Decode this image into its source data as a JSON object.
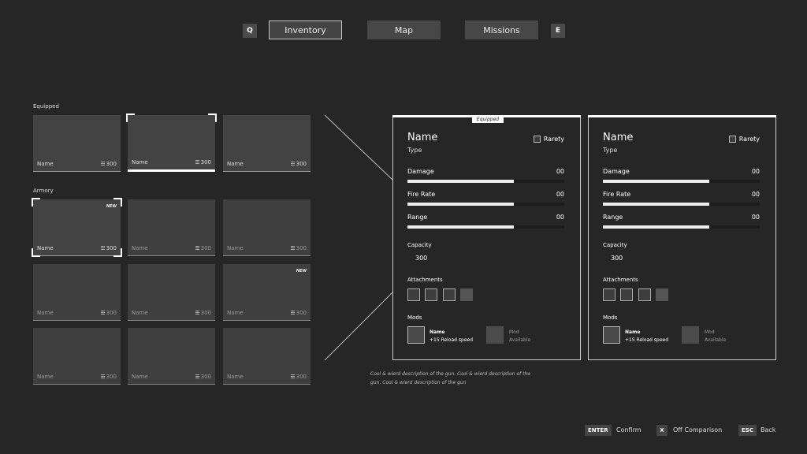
{
  "nav": {
    "prev_key": "Q",
    "next_key": "E",
    "tabs": [
      {
        "label": "Inventory",
        "active": true
      },
      {
        "label": "Map",
        "active": false
      },
      {
        "label": "Missions",
        "active": false
      }
    ]
  },
  "equipped": {
    "label": "Equipped",
    "items": [
      {
        "name": "Name",
        "price": "300"
      },
      {
        "name": "Name",
        "price": "300"
      },
      {
        "name": "Name",
        "price": "300"
      }
    ]
  },
  "armory": {
    "label": "Armory",
    "items": [
      {
        "name": "Name",
        "price": "300",
        "badge": "NEW"
      },
      {
        "name": "Name",
        "price": "300"
      },
      {
        "name": "Name",
        "price": "300"
      },
      {
        "name": "Name",
        "price": "300"
      },
      {
        "name": "Name",
        "price": "300"
      },
      {
        "name": "Name",
        "price": "300",
        "badge": "NEW"
      },
      {
        "name": "Name",
        "price": "300"
      },
      {
        "name": "Name",
        "price": "300"
      },
      {
        "name": "Name",
        "price": "300"
      }
    ]
  },
  "compare": {
    "equipped_tag": "Equipped",
    "panels": [
      {
        "name": "Name",
        "type": "Type",
        "rarity_label": "Rarety",
        "stats": [
          {
            "label": "Damage",
            "value": "00",
            "fill": 0.68
          },
          {
            "label": "Fire Rate",
            "value": "00",
            "fill": 0.68
          },
          {
            "label": "Range",
            "value": "00",
            "fill": 0.68
          }
        ],
        "capacity_label": "Capacity",
        "capacity_value": "300",
        "attachments_label": "Attachments",
        "mods_label": "Mods",
        "mod1_title": "Name",
        "mod1_desc": "+15 Reload speed",
        "mod2_title": "Mod",
        "mod2_desc": "Available"
      },
      {
        "name": "Name",
        "type": "Type",
        "rarity_label": "Rarety",
        "stats": [
          {
            "label": "Damage",
            "value": "00",
            "fill": 0.68
          },
          {
            "label": "Fire Rate",
            "value": "00",
            "fill": 0.68
          },
          {
            "label": "Range",
            "value": "00",
            "fill": 0.68
          }
        ],
        "capacity_label": "Capacity",
        "capacity_value": "300",
        "attachments_label": "Attachments",
        "mods_label": "Mods",
        "mod1_title": "Name",
        "mod1_desc": "+15 Reload speed",
        "mod2_title": "Mod",
        "mod2_desc": "Available"
      }
    ],
    "description": "Cool & wierd description of the gun. Cool & wierd description of the gun. Cool & wierd description of the gun"
  },
  "footer": [
    {
      "key": "ENTER",
      "label": "Confirm"
    },
    {
      "key": "X",
      "label": "Off Comparison"
    },
    {
      "key": "ESC",
      "label": "Back"
    }
  ]
}
